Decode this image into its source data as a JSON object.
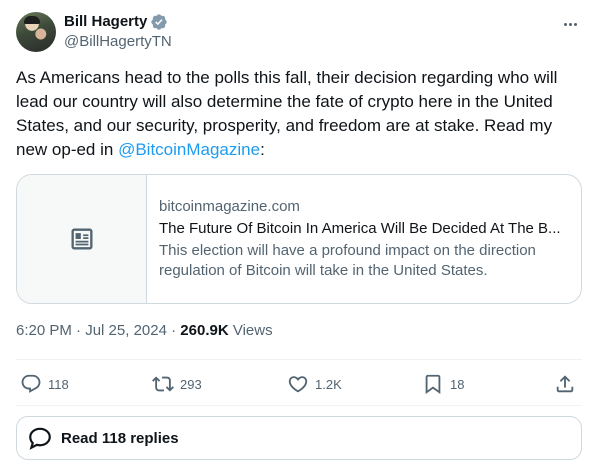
{
  "author": {
    "name": "Bill Hagerty",
    "handle": "@BillHagertyTN",
    "verified_color": "#829aab"
  },
  "tweet": {
    "text_before": "As Americans head to the polls this fall, their decision regarding who will lead our country will also determine the fate of crypto here in the United States, and our security, prosperity, and freedom are at stake. Read my new op-ed in ",
    "mention": "@BitcoinMagazine",
    "text_after": ":"
  },
  "card": {
    "domain": "bitcoinmagazine.com",
    "title": "The Future Of Bitcoin In America Will Be Decided At The B...",
    "description": "This election will have a profound impact on the direction regulation of Bitcoin will take in the United States."
  },
  "meta": {
    "time": "6:20 PM",
    "date": "Jul 25, 2024",
    "separator": "·",
    "views_count": "260.9K",
    "views_label": " Views"
  },
  "actions": {
    "replies": "118",
    "reposts": "293",
    "likes": "1.2K",
    "bookmarks": "18"
  },
  "read_replies": "Read 118 replies",
  "colors": {
    "accent": "#1d9bf0",
    "muted": "#536471",
    "border": "#cfd9de"
  }
}
